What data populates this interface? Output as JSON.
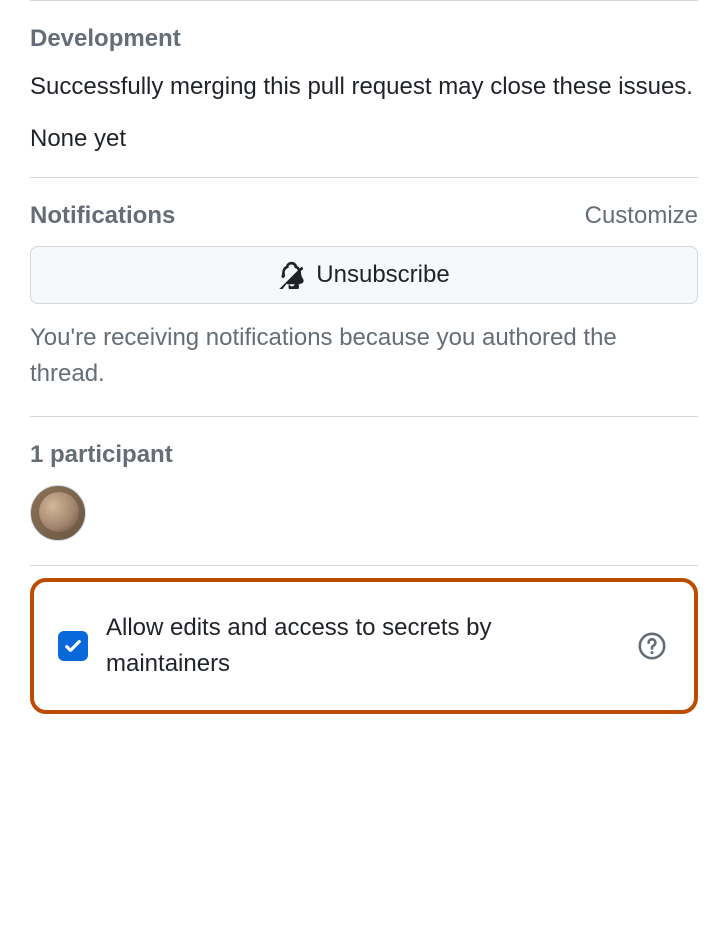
{
  "development": {
    "title": "Development",
    "description": "Successfully merging this pull request may close these issues.",
    "none_yet": "None yet"
  },
  "notifications": {
    "title": "Notifications",
    "customize": "Customize",
    "unsubscribe_label": "Unsubscribe",
    "reason": "You're receiving notifications because you authored the thread."
  },
  "participants": {
    "count_label": "1 participant"
  },
  "allow_edits": {
    "label": "Allow edits and access to secrets by maintainers",
    "checked": true
  }
}
